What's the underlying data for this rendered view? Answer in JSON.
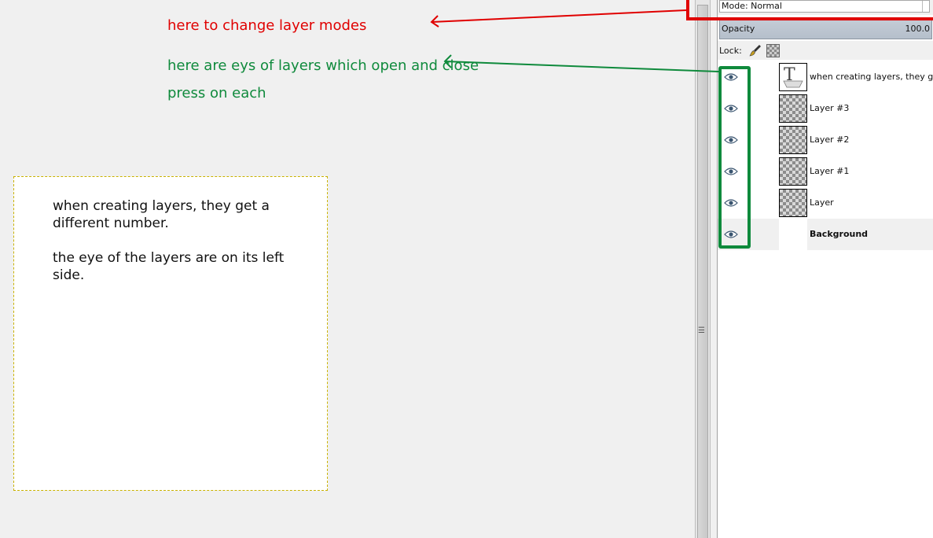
{
  "annotations": {
    "mode_note": "here to change layer modes",
    "eyes_note": "here are eys of layers which open and close",
    "press_note": "press on each",
    "mode_color": "#e00000",
    "eyes_color": "#0f8a3c"
  },
  "canvas": {
    "line1": "when creating layers, they get a different number.",
    "line2": "the eye of the layers are on its left side."
  },
  "layers_panel": {
    "mode_label": "Mode: Normal",
    "opacity_label": "Opacity",
    "opacity_value": "100.0",
    "lock_label": "Lock:",
    "layers": [
      {
        "name": "when creating layers, they get",
        "thumb": "text-layer-icon",
        "visible": true,
        "bold": false
      },
      {
        "name": "Layer #3",
        "thumb": "transparent-checker",
        "visible": true,
        "bold": false
      },
      {
        "name": "Layer #2",
        "thumb": "transparent-checker",
        "visible": true,
        "bold": false
      },
      {
        "name": "Layer #1",
        "thumb": "transparent-checker",
        "visible": true,
        "bold": false
      },
      {
        "name": "Layer",
        "thumb": "transparent-checker",
        "visible": true,
        "bold": false
      },
      {
        "name": "Background",
        "thumb": "white",
        "visible": true,
        "bold": true
      }
    ]
  },
  "icons": {
    "eye": "eye-icon",
    "lock_pixels": "paintbrush-icon",
    "lock_alpha": "checkerboard-icon",
    "resize_grip": "grip-icon"
  }
}
